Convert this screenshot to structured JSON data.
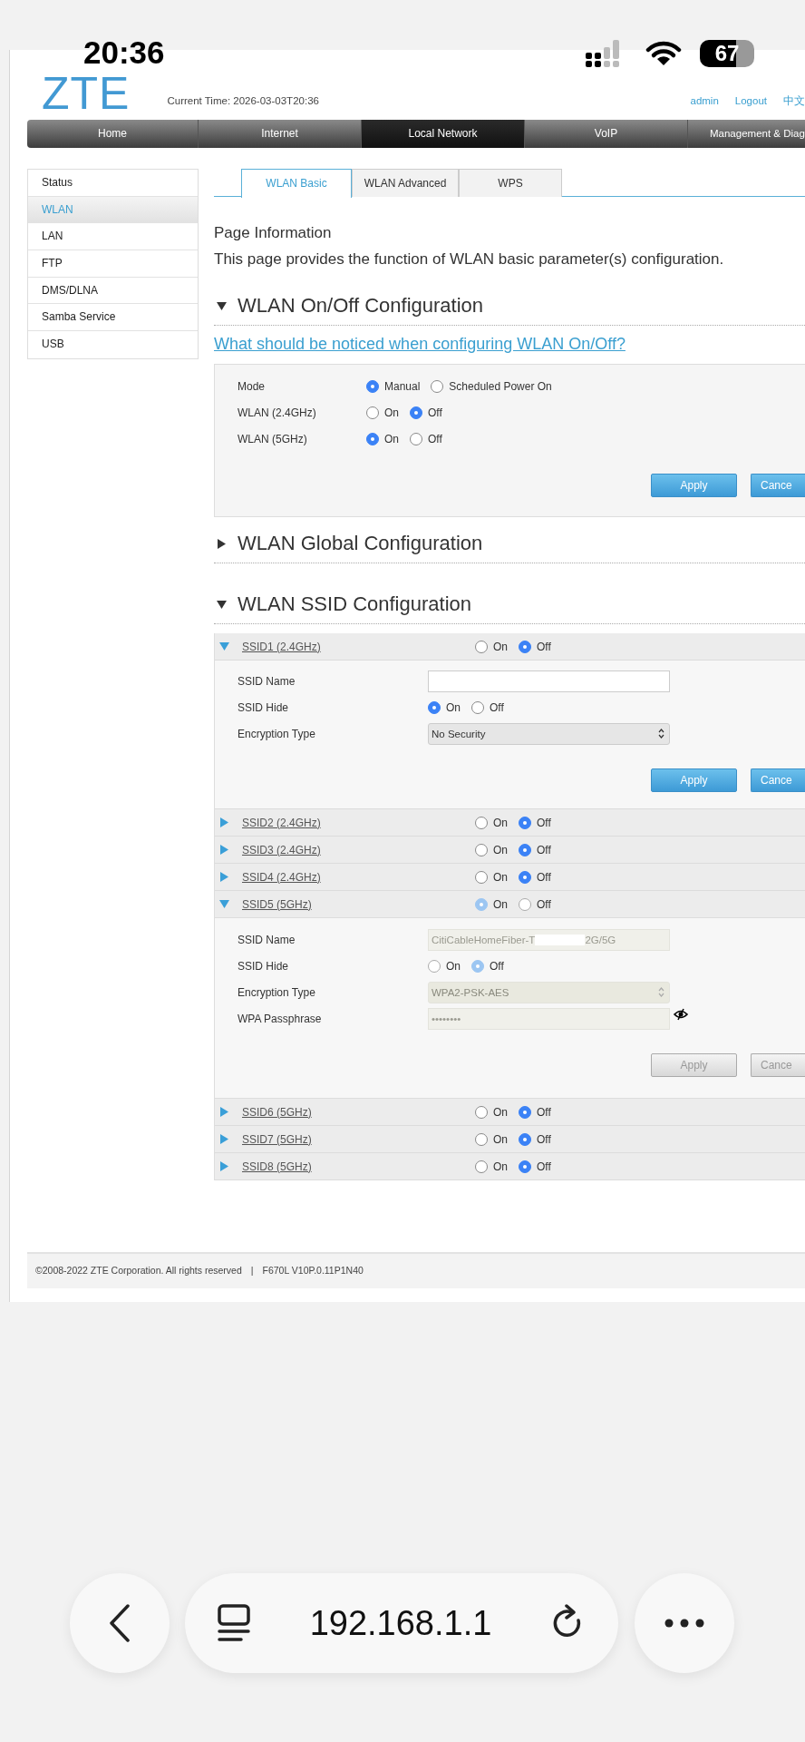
{
  "status_bar": {
    "time": "20:36",
    "battery": "67"
  },
  "header": {
    "logo": "ZTE",
    "current_time": "Current Time: 2026-03-03T20:36",
    "links": [
      "admin",
      "Logout",
      "中文"
    ]
  },
  "nav": [
    {
      "label": "Home",
      "selected": false
    },
    {
      "label": "Internet",
      "selected": false
    },
    {
      "label": "Local Network",
      "selected": true
    },
    {
      "label": "VoIP",
      "selected": false
    },
    {
      "label": "Management & Diag",
      "selected": false
    }
  ],
  "sidebar": [
    {
      "label": "Status",
      "selected": false
    },
    {
      "label": "WLAN",
      "selected": true
    },
    {
      "label": "LAN",
      "selected": false
    },
    {
      "label": "FTP",
      "selected": false
    },
    {
      "label": "DMS/DLNA",
      "selected": false
    },
    {
      "label": "Samba Service",
      "selected": false
    },
    {
      "label": "USB",
      "selected": false
    }
  ],
  "tabs": [
    {
      "label": "WLAN Basic",
      "selected": true
    },
    {
      "label": "WLAN Advanced",
      "selected": false
    },
    {
      "label": "WPS",
      "selected": false
    }
  ],
  "page_info": {
    "title": "Page Information",
    "text": "This page provides the function of WLAN basic parameter(s) configuration."
  },
  "sections": [
    {
      "title": "WLAN On/Off Configuration",
      "expanded": true,
      "help_link": "What should be noticed when configuring WLAN On/Off?",
      "form": {
        "rows": [
          {
            "label": "Mode",
            "options": [
              {
                "label": "Manual",
                "selected": true
              },
              {
                "label": "Scheduled Power On",
                "selected": false
              }
            ]
          },
          {
            "label": "WLAN (2.4GHz)",
            "options": [
              {
                "label": "On",
                "selected": false
              },
              {
                "label": "Off",
                "selected": true
              }
            ]
          },
          {
            "label": "WLAN (5GHz)",
            "options": [
              {
                "label": "On",
                "selected": true
              },
              {
                "label": "Off",
                "selected": false
              }
            ]
          }
        ],
        "buttons": [
          "Apply",
          "Cance"
        ]
      }
    },
    {
      "title": "WLAN Global Configuration",
      "expanded": false
    },
    {
      "title": "WLAN SSID Configuration",
      "expanded": true,
      "ssids": [
        {
          "label": "SSID1 (2.4GHz)",
          "expanded": true,
          "disabled": false,
          "options": [
            {
              "label": "On",
              "selected": false
            },
            {
              "label": "Off",
              "selected": true
            }
          ],
          "fields": [
            {
              "kind": "text",
              "label": "SSID Name"
            },
            {
              "kind": "radio",
              "label": "SSID Hide",
              "options": [
                {
                  "label": "On",
                  "selected": true
                },
                {
                  "label": "Off",
                  "selected": false
                }
              ]
            },
            {
              "kind": "select",
              "label": "Encryption Type",
              "value": "No Security"
            }
          ],
          "buttons": [
            "Apply",
            "Cance"
          ]
        },
        {
          "label": "SSID2 (2.4GHz)",
          "expanded": false,
          "disabled": false,
          "options": [
            {
              "label": "On",
              "selected": false
            },
            {
              "label": "Off",
              "selected": true
            }
          ]
        },
        {
          "label": "SSID3 (2.4GHz)",
          "expanded": false,
          "disabled": false,
          "options": [
            {
              "label": "On",
              "selected": false
            },
            {
              "label": "Off",
              "selected": true
            }
          ]
        },
        {
          "label": "SSID4 (2.4GHz)",
          "expanded": false,
          "disabled": false,
          "options": [
            {
              "label": "On",
              "selected": false
            },
            {
              "label": "Off",
              "selected": true
            }
          ]
        },
        {
          "label": "SSID5 (5GHz)",
          "expanded": true,
          "disabled": true,
          "options": [
            {
              "label": "On",
              "selected": true
            },
            {
              "label": "Off",
              "selected": false
            }
          ],
          "fields": [
            {
              "kind": "text",
              "label": "SSID Name",
              "value_before": "CitiCableHomeFiber-T",
              "value_after": "2G/5G"
            },
            {
              "kind": "radio",
              "label": "SSID Hide",
              "options": [
                {
                  "label": "On",
                  "selected": false
                },
                {
                  "label": "Off",
                  "selected": true
                }
              ]
            },
            {
              "kind": "select",
              "label": "Encryption Type",
              "value": "WPA2-PSK-AES"
            },
            {
              "kind": "password",
              "label": "WPA Passphrase",
              "value": "••••••••"
            }
          ],
          "buttons": [
            "Apply",
            "Cance"
          ]
        },
        {
          "label": "SSID6 (5GHz)",
          "expanded": false,
          "disabled": false,
          "options": [
            {
              "label": "On",
              "selected": false
            },
            {
              "label": "Off",
              "selected": true
            }
          ]
        },
        {
          "label": "SSID7 (5GHz)",
          "expanded": false,
          "disabled": false,
          "options": [
            {
              "label": "On",
              "selected": false
            },
            {
              "label": "Off",
              "selected": true
            }
          ]
        },
        {
          "label": "SSID8 (5GHz)",
          "expanded": false,
          "disabled": false,
          "options": [
            {
              "label": "On",
              "selected": false
            },
            {
              "label": "Off",
              "selected": true
            }
          ]
        }
      ]
    }
  ],
  "footer": {
    "copyright": "©2008-2022 ZTE Corporation. All rights reserved",
    "separator": "|",
    "version": "F670L V10P.0.11P1N40"
  },
  "browser": {
    "url": "192.168.1.1"
  }
}
